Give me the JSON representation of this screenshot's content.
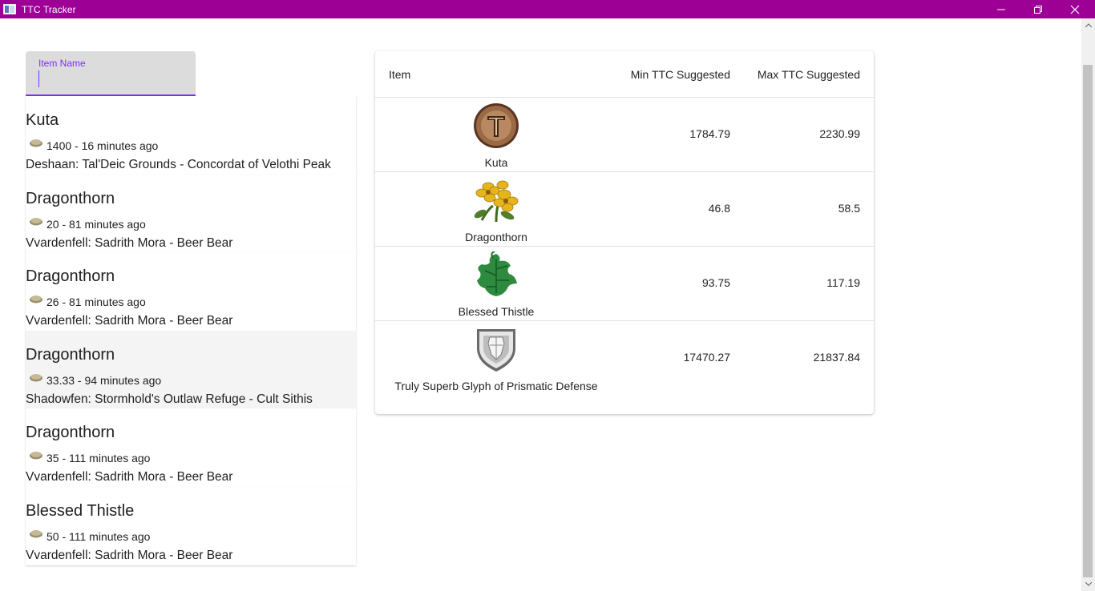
{
  "window": {
    "title": "TTC Tracker"
  },
  "search": {
    "label": "Item Name",
    "value": ""
  },
  "listings": [
    {
      "name": "Kuta",
      "meta": "1400 - 16 minutes ago",
      "location": "Deshaan: Tal'Deic Grounds - Concordat of Velothi Peak",
      "highlighted": false
    },
    {
      "name": "Dragonthorn",
      "meta": "20 - 81 minutes ago",
      "location": "Vvardenfell: Sadrith Mora - Beer Bear",
      "highlighted": false
    },
    {
      "name": "Dragonthorn",
      "meta": "26 - 81 minutes ago",
      "location": "Vvardenfell: Sadrith Mora - Beer Bear",
      "highlighted": false
    },
    {
      "name": "Dragonthorn",
      "meta": "33.33 - 94 minutes ago",
      "location": "Shadowfen: Stormhold's Outlaw Refuge - Cult Sithis",
      "highlighted": true
    },
    {
      "name": "Dragonthorn",
      "meta": "35 - 111 minutes ago",
      "location": "Vvardenfell: Sadrith Mora - Beer Bear",
      "highlighted": false
    },
    {
      "name": "Blessed Thistle",
      "meta": "50 - 111 minutes ago",
      "location": "Vvardenfell: Sadrith Mora - Beer Bear",
      "highlighted": false
    }
  ],
  "table": {
    "headers": {
      "item": "Item",
      "min": "Min TTC Suggested",
      "max": "Max TTC Suggested"
    },
    "rows": [
      {
        "name": "Kuta",
        "icon": "kuta-rune-icon",
        "min": "1784.79",
        "max": "2230.99"
      },
      {
        "name": "Dragonthorn",
        "icon": "dragonthorn-flower-icon",
        "min": "46.8",
        "max": "58.5"
      },
      {
        "name": "Blessed Thistle",
        "icon": "blessed-thistle-leaf-icon",
        "min": "93.75",
        "max": "117.19"
      },
      {
        "name": "Truly Superb Glyph of Prismatic Defense",
        "icon": "glyph-shield-icon",
        "min": "17470.27",
        "max": "21837.84"
      }
    ]
  },
  "colors": {
    "titlebar": "#9c0095",
    "accent": "#7b2ff7"
  }
}
